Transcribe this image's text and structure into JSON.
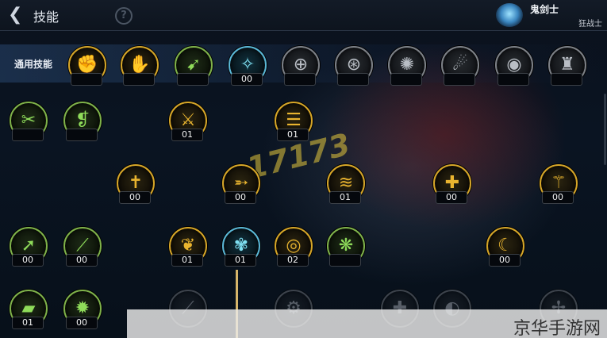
{
  "header": {
    "back_glyph": "❮",
    "title": "技能",
    "help_glyph": "?",
    "class_name": "鬼剑士",
    "subclass": "狂战士"
  },
  "row_label": "通用技能",
  "watermark": "17173",
  "brand": "京华手游网",
  "skills": [
    {
      "id": "s1",
      "style": "gold",
      "glyph": "✊",
      "level": ""
    },
    {
      "id": "s2",
      "style": "gold",
      "glyph": "✋",
      "level": ""
    },
    {
      "id": "s3",
      "style": "green",
      "glyph": "➹",
      "level": ""
    },
    {
      "id": "s4",
      "style": "blue",
      "glyph": "✧",
      "level": "00"
    },
    {
      "id": "s5",
      "style": "gray",
      "glyph": "⊕",
      "level": ""
    },
    {
      "id": "s6",
      "style": "gray",
      "glyph": "⊛",
      "level": ""
    },
    {
      "id": "s7",
      "style": "gray",
      "glyph": "✺",
      "level": ""
    },
    {
      "id": "s8",
      "style": "gray",
      "glyph": "☄",
      "level": ""
    },
    {
      "id": "s9",
      "style": "gray",
      "glyph": "◉",
      "level": ""
    },
    {
      "id": "s10",
      "style": "gray",
      "glyph": "♜",
      "level": ""
    },
    {
      "id": "r2a",
      "style": "green",
      "glyph": "✂",
      "level": ""
    },
    {
      "id": "r2b",
      "style": "green",
      "glyph": "❡",
      "level": ""
    },
    {
      "id": "r2c",
      "style": "gold",
      "glyph": "⚔",
      "level": "01"
    },
    {
      "id": "r2d",
      "style": "gold",
      "glyph": "☰",
      "level": "01"
    },
    {
      "id": "r3a",
      "style": "gold",
      "glyph": "✝",
      "level": "00"
    },
    {
      "id": "r3b",
      "style": "gold",
      "glyph": "➵",
      "level": "00"
    },
    {
      "id": "r3c",
      "style": "gold",
      "glyph": "≋",
      "level": "01"
    },
    {
      "id": "r3d",
      "style": "gold",
      "glyph": "✚",
      "level": "00"
    },
    {
      "id": "r3e",
      "style": "gold",
      "glyph": "⚚",
      "level": "00"
    },
    {
      "id": "r4a",
      "style": "green",
      "glyph": "➚",
      "level": "00"
    },
    {
      "id": "r4b",
      "style": "green",
      "glyph": "⟋",
      "level": "00"
    },
    {
      "id": "r4c",
      "style": "gold",
      "glyph": "❦",
      "level": "01"
    },
    {
      "id": "r4d",
      "style": "blue",
      "glyph": "✾",
      "level": "01"
    },
    {
      "id": "r4e",
      "style": "gold",
      "glyph": "◎",
      "level": "02"
    },
    {
      "id": "r4f",
      "style": "green",
      "glyph": "❋",
      "level": ""
    },
    {
      "id": "r4g",
      "style": "gold",
      "glyph": "☾",
      "level": "00"
    },
    {
      "id": "r5a",
      "style": "green",
      "glyph": "▰",
      "level": "01"
    },
    {
      "id": "r5b",
      "style": "green",
      "glyph": "✹",
      "level": "00"
    },
    {
      "id": "r5c",
      "style": "gray",
      "glyph": "⟋",
      "level": ""
    },
    {
      "id": "r5d",
      "style": "gray",
      "glyph": "⚙",
      "level": ""
    },
    {
      "id": "r5e",
      "style": "gray",
      "glyph": "✚",
      "level": ""
    },
    {
      "id": "r5f",
      "style": "gray",
      "glyph": "◐",
      "level": ""
    },
    {
      "id": "r5g",
      "style": "gray",
      "glyph": "✢",
      "level": ""
    }
  ]
}
